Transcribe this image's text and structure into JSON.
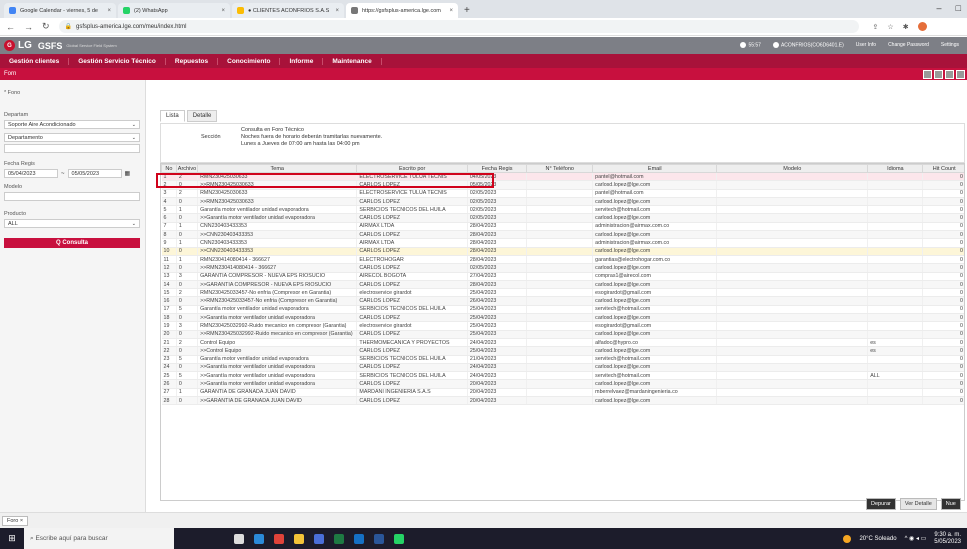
{
  "browser": {
    "tabs": [
      {
        "label": "Google Calendar - viernes, 5 de",
        "color": "#4285f4"
      },
      {
        "label": "(2) WhatsApp",
        "color": "#25d366"
      },
      {
        "label": "● CLIENTES ACONFRIOS S.A.S",
        "color": "#fbbc04"
      },
      {
        "label": "https://gsfsplus-america.lge.com",
        "color": "#777777"
      }
    ],
    "url": "gsfsplus-america.lge.com/meu/index.html"
  },
  "header": {
    "logo": "LG",
    "app": "GSFS",
    "sys": "Global Service Field System",
    "time": "55:57",
    "user": "ACONFRIOS(CO6D6401.E)",
    "links": [
      "User Info",
      "Change Password",
      "Settings"
    ]
  },
  "menu": [
    "Gestión clientes",
    "Gestión Servicio Técnico",
    "Repuestos",
    "Conocimiento",
    "Informe",
    "Maintenance"
  ],
  "subbar_title": "Forn",
  "side": {
    "fono_label": "* Fono",
    "depart_label": "Departam",
    "depart_value": "Soporte Aire Acondicionado",
    "dep2_value": "Departamento",
    "fecha_label": "Fecha Regis",
    "date_from": "05/04/2023",
    "date_to": "05/05/2023",
    "modelo_label": "Modelo",
    "producto_label": "Producto",
    "producto_value": "ALL",
    "consulta": "Q Consulta"
  },
  "tabs2": [
    "Lista",
    "Detalle"
  ],
  "info": {
    "line1": "Consulta en Foro Técnico",
    "seccion": "Sección",
    "line2": "Noches fuera de horario deberán tramitarlas nuevamente.",
    "line3": "Lunes a Jueves de 07:00 am hasta las 04:00 pm"
  },
  "columns": [
    "No",
    "Archivo",
    "Tema",
    "Escrito por",
    "Fecha Regis",
    "N° Teléfono",
    "Email",
    "Modelo",
    "Idioma",
    "Hit Count"
  ],
  "rows": [
    [
      "1",
      "2",
      "RMN230425030633",
      "ELECTROSERVICE TULUA TECNIS",
      "04/05/2023",
      "",
      "pantel@hotmail.com",
      "",
      "",
      "0"
    ],
    [
      "2",
      "0",
      "  >>RMN230425030633",
      "CARLOS LOPEZ",
      "05/05/2023",
      "",
      "carlosd.lopez@lge.com",
      "",
      "",
      "0"
    ],
    [
      "3",
      "2",
      "RMN230425030633",
      "ELECTROSERVICE TULUA TECNIS",
      "02/05/2023",
      "",
      "pantel@hotmail.com",
      "",
      "",
      "0"
    ],
    [
      "4",
      "0",
      "  >>RMN230425030633",
      "CARLOS LOPEZ",
      "02/05/2023",
      "",
      "carlosd.lopez@lge.com",
      "",
      "",
      "0"
    ],
    [
      "5",
      "1",
      "Garantía motor ventilador unidad evaporadora",
      "SERBICIOS TECNICOS DEL HUILA",
      "02/05/2023",
      "",
      "servitech@hotmail.com",
      "",
      "",
      "0"
    ],
    [
      "6",
      "0",
      "  >>Garantía motor ventilador unidad evaporadora",
      "CARLOS LOPEZ",
      "02/05/2023",
      "",
      "carlosd.lopez@lge.com",
      "",
      "",
      "0"
    ],
    [
      "7",
      "1",
      "CNN230403433353",
      "AIRMAX LTDA",
      "28/04/2023",
      "",
      "administracion@airmax.com.co",
      "",
      "",
      "0"
    ],
    [
      "8",
      "0",
      "  >>CNN230403433353",
      "CARLOS LOPEZ",
      "28/04/2023",
      "",
      "carlosd.lopez@lge.com",
      "",
      "",
      "0"
    ],
    [
      "9",
      "1",
      "CNN230403433353",
      "AIRMAX LTDA",
      "28/04/2023",
      "",
      "administracion@airmax.com.co",
      "",
      "",
      "0"
    ],
    [
      "10",
      "0",
      "  >>CNN230403433353",
      "CARLOS LOPEZ",
      "28/04/2023",
      "",
      "carlosd.lopez@lge.com",
      "",
      "",
      "0"
    ],
    [
      "11",
      "1",
      "RMN230414080414 - 366627",
      "ELECTROHOGAR",
      "28/04/2023",
      "",
      "garantias@electrohogar.com.co",
      "",
      "",
      "0"
    ],
    [
      "12",
      "0",
      "  >>RMN230414080414 - 366627",
      "CARLOS LOPEZ",
      "02/05/2023",
      "",
      "carlosd.lopez@lge.com",
      "",
      "",
      "0"
    ],
    [
      "13",
      "3",
      "GARANTIA COMPRESOR - NUEVA EPS RIOSUCIO",
      "AIRECOL BOGOTA",
      "27/04/2023",
      "",
      "compras1@airecol.com",
      "",
      "",
      "0"
    ],
    [
      "14",
      "0",
      "  >>GARANTIA COMPRESOR - NUEVA EPS RIOSUCIO",
      "CARLOS LOPEZ",
      "28/04/2023",
      "",
      "carlosd.lopez@lge.com",
      "",
      "",
      "0"
    ],
    [
      "15",
      "2",
      "RMN230425033457-No enfria (Compresor en Garantia)",
      "electroservice girardot",
      "25/04/2023",
      "",
      "esogirardot@gmail.com",
      "",
      "",
      "0"
    ],
    [
      "16",
      "0",
      "  >>RMN230425033457-No enfria (Compresor en Garantia)",
      "CARLOS LOPEZ",
      "26/04/2023",
      "",
      "carlosd.lopez@lge.com",
      "",
      "",
      "0"
    ],
    [
      "17",
      "5",
      "Garantía motor ventilador unidad evaporadora",
      "SERBICIOS TECNICOS DEL HUILA",
      "25/04/2023",
      "",
      "servitech@hotmail.com",
      "",
      "",
      "0"
    ],
    [
      "18",
      "0",
      "  >>Garantía motor ventilador unidad evaporadora",
      "CARLOS LOPEZ",
      "25/04/2023",
      "",
      "carlosd.lopez@lge.com",
      "",
      "",
      "0"
    ],
    [
      "19",
      "3",
      "RMN230425032992-Ruido mecanico en compresor (Garantia)",
      "electroservice girardot",
      "25/04/2023",
      "",
      "esogirardot@gmail.com",
      "",
      "",
      "0"
    ],
    [
      "20",
      "0",
      "  >>RMN230425032992-Ruido mecanico en compresor (Garantia)",
      "CARLOS LOPEZ",
      "25/04/2023",
      "",
      "carlosd.lopez@lge.com",
      "",
      "",
      "0"
    ],
    [
      "21",
      "2",
      "Control Equipo",
      "THERMOMECANICA Y PROYECTOS",
      "24/04/2023",
      "",
      "alfadoc@hypro.co",
      "",
      "es",
      "0"
    ],
    [
      "22",
      "0",
      "  >>Control Equipo",
      "CARLOS LOPEZ",
      "25/04/2023",
      "",
      "carlosd.lopez@lge.com",
      "",
      "es",
      "0"
    ],
    [
      "23",
      "5",
      "Garantía motor ventilador unidad evaporadora",
      "SERBICIOS TECNICOS DEL HUILA",
      "21/04/2023",
      "",
      "servitech@hotmail.com",
      "",
      "",
      "0"
    ],
    [
      "24",
      "0",
      "  >>Garantía motor ventilador unidad evaporadora",
      "CARLOS LOPEZ",
      "24/04/2023",
      "",
      "carlosd.lopez@lge.com",
      "",
      "",
      "0"
    ],
    [
      "25",
      "5",
      "    >>Garantía motor ventilador unidad evaporadora",
      "SERBICIOS TECNICOS DEL HUILA",
      "24/04/2023",
      "",
      "servitech@hotmail.com",
      "",
      "ALL",
      "0"
    ],
    [
      "26",
      "0",
      "      >>Garantía motor ventilador unidad evaporadora",
      "CARLOS LOPEZ",
      "20/04/2023",
      "",
      "carlosd.lopez@lge.com",
      "",
      "",
      "0"
    ],
    [
      "27",
      "1",
      "GARANTIA DE GRANADA JUAN DAVID",
      "MARDANI INGENIERIA S.A.S",
      "20/04/2023",
      "",
      "mberrelvaez@mardaningenieria.co",
      "",
      "",
      "0"
    ],
    [
      "28",
      "0",
      "  >>GARANTIA DE GRANADA JUAN DAVID",
      "CARLOS LOPEZ",
      "20/04/2023",
      "",
      "carlosd.lopez@lge.com",
      "",
      "",
      "0"
    ]
  ],
  "buttons": [
    "Depurar",
    "Ver Detalle",
    "Nue"
  ],
  "bottom_tab": "Foro",
  "taskbar": {
    "search": "Escribe aquí para buscar",
    "weather": "20°C Soleado",
    "time": "9:30 a. m.",
    "date": "5/05/2023"
  }
}
